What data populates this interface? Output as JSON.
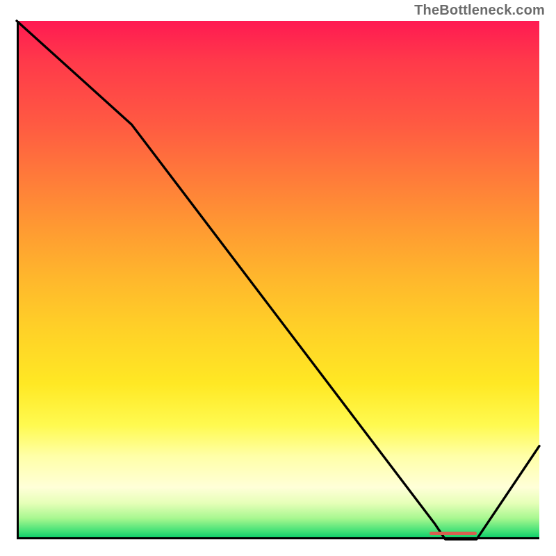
{
  "watermark": "TheBottleneck.com",
  "chart_data": {
    "type": "line",
    "title": "",
    "xlabel": "",
    "ylabel": "",
    "xlim": [
      0,
      100
    ],
    "ylim": [
      0,
      100
    ],
    "grid": false,
    "x": [
      0,
      22,
      80,
      82,
      88,
      100
    ],
    "values": [
      100,
      80,
      3,
      0,
      0,
      18
    ],
    "gradient_colors": {
      "top": "#ff1a52",
      "mid_top": "#ff9a32",
      "mid": "#ffe824",
      "mid_bot": "#ffffd8",
      "bottom": "#00c868"
    },
    "optimal_marker": {
      "x_start": 79,
      "x_end": 88,
      "y": 0.8,
      "color": "#d7604f"
    }
  }
}
